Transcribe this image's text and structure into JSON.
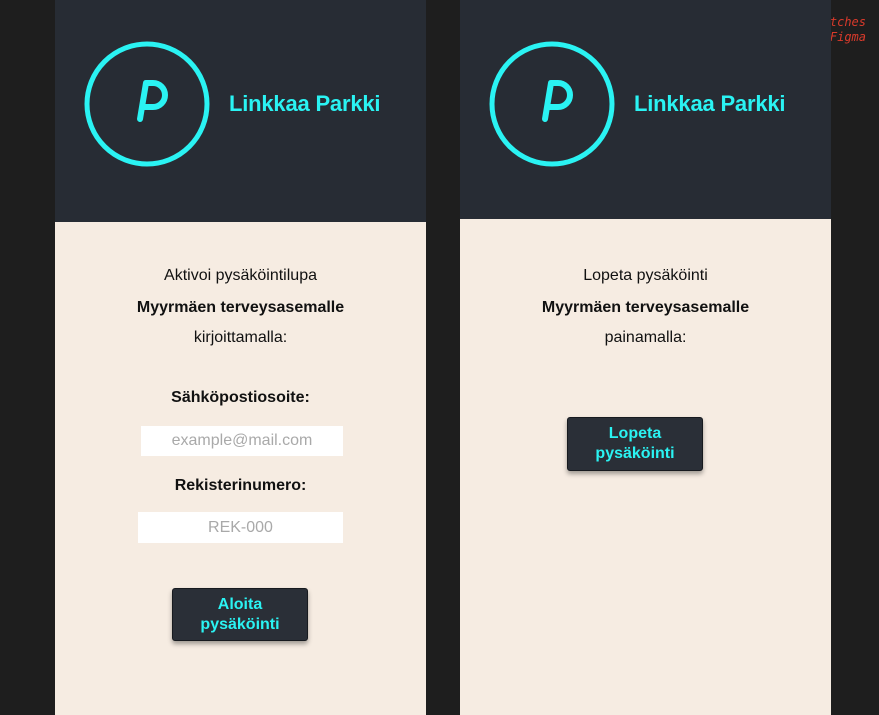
{
  "caption": {
    "line1": "Application Layout Sketches",
    "line2": "Drawn by Using Figma"
  },
  "app": {
    "name": "Linkkaa Parkki",
    "logo_letter": "P",
    "accent_color": "#2af3f3",
    "header_color": "#272c34",
    "content_background": "#f6ece2"
  },
  "start_screen": {
    "intro_line1": "Aktivoi pysäköintilupa",
    "intro_line2": "Myyrmäen terveysasemalle",
    "intro_line3": "kirjoittamalla:",
    "email_label": "Sähköpostiosoite:",
    "email_placeholder": "example@mail.com",
    "plate_label": "Rekisterinumero:",
    "plate_placeholder": "REK-000",
    "button_line1": "Aloita",
    "button_line2": "pysäköinti"
  },
  "stop_screen": {
    "intro_line1": "Lopeta pysäköinti",
    "intro_line2": "Myyrmäen terveysasemalle",
    "intro_line3": "painamalla:",
    "button_line1": "Lopeta",
    "button_line2": "pysäköinti"
  }
}
